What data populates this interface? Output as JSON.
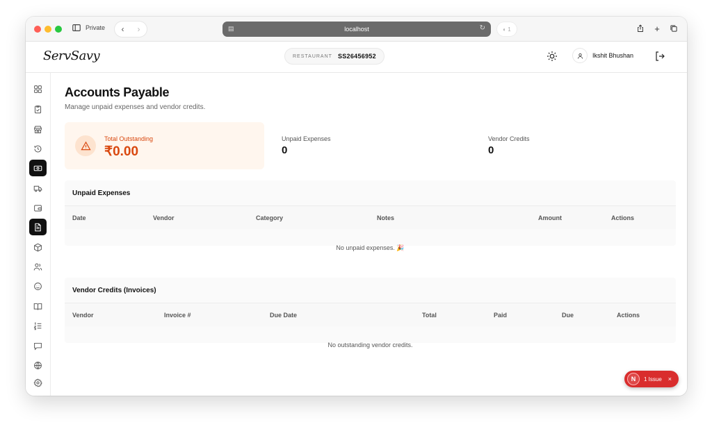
{
  "browser": {
    "tab_mode": "Private",
    "url": "localhost",
    "shield_count": "1"
  },
  "header": {
    "logo": "ServSavy",
    "restaurant_label": "RESTAURANT",
    "restaurant_code": "SS26456952",
    "user_name": "Ikshit Bhushan"
  },
  "sidebar": {
    "items": [
      {
        "icon": "dashboard-icon",
        "active": false
      },
      {
        "icon": "clipboard-check-icon",
        "active": false
      },
      {
        "icon": "store-icon",
        "active": false
      },
      {
        "icon": "history-icon",
        "active": false
      },
      {
        "icon": "cash-icon",
        "active": true
      },
      {
        "icon": "truck-icon",
        "active": false
      },
      {
        "icon": "wallet-icon",
        "active": false
      },
      {
        "icon": "document-icon",
        "active": true
      },
      {
        "icon": "box-icon",
        "active": false
      },
      {
        "icon": "users-icon",
        "active": false
      },
      {
        "icon": "smile-icon",
        "active": false
      },
      {
        "icon": "book-icon",
        "active": false
      },
      {
        "icon": "list-ordered-icon",
        "active": false
      },
      {
        "icon": "message-icon",
        "active": false
      },
      {
        "icon": "globe-icon",
        "active": false
      },
      {
        "icon": "settings-icon",
        "active": false
      }
    ]
  },
  "page": {
    "title": "Accounts Payable",
    "subtitle": "Manage unpaid expenses and vendor credits."
  },
  "stats": {
    "total_outstanding_label": "Total Outstanding",
    "total_outstanding_value": "₹0.00",
    "unpaid_expenses_label": "Unpaid Expenses",
    "unpaid_expenses_value": "0",
    "vendor_credits_label": "Vendor Credits",
    "vendor_credits_value": "0"
  },
  "unpaid_expenses": {
    "title": "Unpaid Expenses",
    "columns": [
      "Date",
      "Vendor",
      "Category",
      "Notes",
      "Amount",
      "Actions"
    ],
    "empty_text": "No unpaid expenses. 🎉"
  },
  "vendor_credits": {
    "title": "Vendor Credits (Invoices)",
    "columns": [
      "Vendor",
      "Invoice #",
      "Due Date",
      "Total",
      "Paid",
      "Due",
      "Actions"
    ],
    "empty_text": "No outstanding vendor credits."
  },
  "issue_badge": {
    "letter": "N",
    "label": "1 Issue",
    "close": "×"
  },
  "colors": {
    "accent_orange": "#d9480f",
    "card_bg": "#fff6ee",
    "active_sidebar": "#111111",
    "issue_red": "#d92d2d"
  }
}
